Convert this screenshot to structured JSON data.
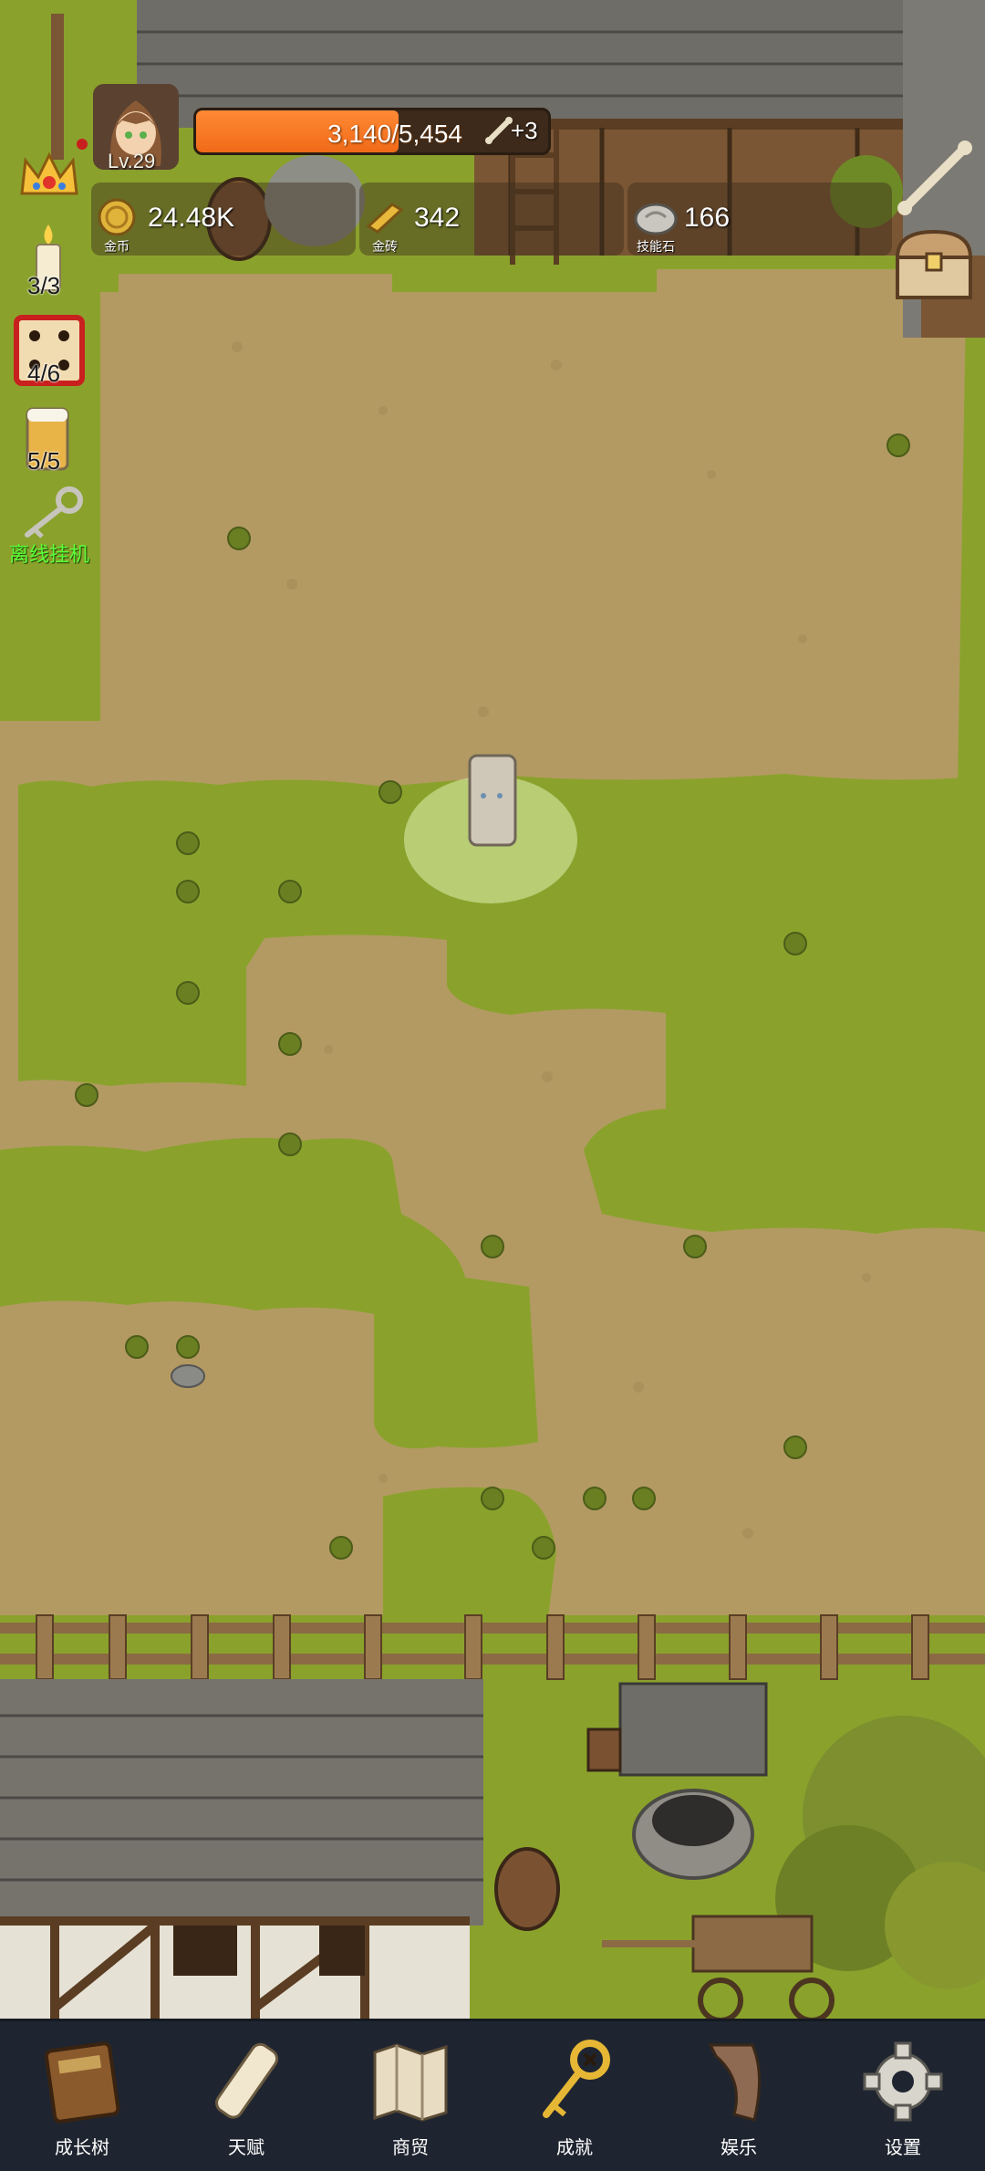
{
  "player": {
    "level": "Lv.29",
    "xp_text": "3,140/5,454",
    "xp_fraction": 0.5757,
    "xp_bonus": "+3"
  },
  "resources": {
    "gold": {
      "value": "24.48K",
      "label": "金币",
      "icon": "gold-coin-icon"
    },
    "gold_brick": {
      "value": "342",
      "label": "金砖",
      "icon": "gold-bar-icon"
    },
    "skill_stone": {
      "value": "166",
      "label": "技能石",
      "icon": "skill-stone-icon"
    }
  },
  "side_buttons": {
    "candle_count": "3/3",
    "dice_count": "4/6",
    "beer_count": "5/5",
    "idle_label": "离线挂机"
  },
  "bottom_nav": [
    {
      "label": "成长树",
      "icon": "book-icon"
    },
    {
      "label": "天赋",
      "icon": "scroll-icon"
    },
    {
      "label": "商贸",
      "icon": "map-icon"
    },
    {
      "label": "成就",
      "icon": "key-icon"
    },
    {
      "label": "娱乐",
      "icon": "banner-icon"
    },
    {
      "label": "设置",
      "icon": "gear-icon"
    }
  ],
  "colors": {
    "dirt": "#b39a62",
    "grass": "#8aa22c",
    "xp_bar": "#f06a18",
    "nav_bg": "#1f2530",
    "idle_text": "#5cff3a"
  }
}
